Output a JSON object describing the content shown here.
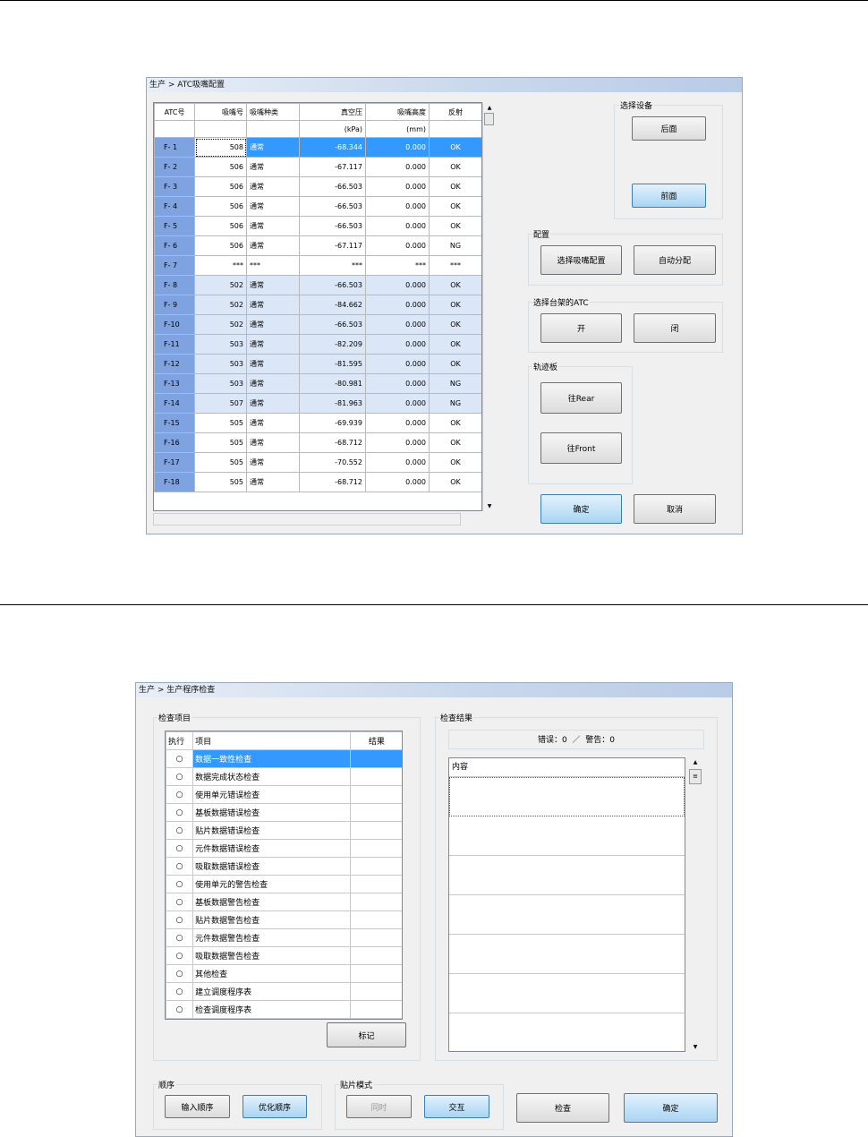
{
  "atc_window": {
    "title": "生产 > ATC吸嘴配置",
    "columns": [
      "ATC号",
      "吸嘴号",
      "吸嘴种类",
      "真空压",
      "吸嘴高度",
      "反射"
    ],
    "units": [
      "",
      "",
      "",
      "(kPa)",
      "(mm)",
      ""
    ],
    "rows": [
      {
        "atc": "F- 1",
        "nozzle": "508",
        "type": "通常",
        "vacuum": "-68.344",
        "height": "0.000",
        "reflect": "OK"
      },
      {
        "atc": "F- 2",
        "nozzle": "506",
        "type": "通常",
        "vacuum": "-67.117",
        "height": "0.000",
        "reflect": "OK"
      },
      {
        "atc": "F- 3",
        "nozzle": "506",
        "type": "通常",
        "vacuum": "-66.503",
        "height": "0.000",
        "reflect": "OK"
      },
      {
        "atc": "F- 4",
        "nozzle": "506",
        "type": "通常",
        "vacuum": "-66.503",
        "height": "0.000",
        "reflect": "OK"
      },
      {
        "atc": "F- 5",
        "nozzle": "506",
        "type": "通常",
        "vacuum": "-66.503",
        "height": "0.000",
        "reflect": "OK"
      },
      {
        "atc": "F- 6",
        "nozzle": "506",
        "type": "通常",
        "vacuum": "-67.117",
        "height": "0.000",
        "reflect": "NG"
      },
      {
        "atc": "F- 7",
        "nozzle": "***",
        "type": "***",
        "vacuum": "***",
        "height": "***",
        "reflect": "***"
      },
      {
        "atc": "F- 8",
        "nozzle": "502",
        "type": "通常",
        "vacuum": "-66.503",
        "height": "0.000",
        "reflect": "OK"
      },
      {
        "atc": "F- 9",
        "nozzle": "502",
        "type": "通常",
        "vacuum": "-84.662",
        "height": "0.000",
        "reflect": "OK"
      },
      {
        "atc": "F-10",
        "nozzle": "502",
        "type": "通常",
        "vacuum": "-66.503",
        "height": "0.000",
        "reflect": "OK"
      },
      {
        "atc": "F-11",
        "nozzle": "503",
        "type": "通常",
        "vacuum": "-82.209",
        "height": "0.000",
        "reflect": "OK"
      },
      {
        "atc": "F-12",
        "nozzle": "503",
        "type": "通常",
        "vacuum": "-81.595",
        "height": "0.000",
        "reflect": "OK"
      },
      {
        "atc": "F-13",
        "nozzle": "503",
        "type": "通常",
        "vacuum": "-80.981",
        "height": "0.000",
        "reflect": "NG"
      },
      {
        "atc": "F-14",
        "nozzle": "507",
        "type": "通常",
        "vacuum": "-81.963",
        "height": "0.000",
        "reflect": "NG"
      },
      {
        "atc": "F-15",
        "nozzle": "505",
        "type": "通常",
        "vacuum": "-69.939",
        "height": "0.000",
        "reflect": "OK"
      },
      {
        "atc": "F-16",
        "nozzle": "505",
        "type": "通常",
        "vacuum": "-68.712",
        "height": "0.000",
        "reflect": "OK"
      },
      {
        "atc": "F-17",
        "nozzle": "505",
        "type": "通常",
        "vacuum": "-70.552",
        "height": "0.000",
        "reflect": "OK"
      },
      {
        "atc": "F-18",
        "nozzle": "505",
        "type": "通常",
        "vacuum": "-68.712",
        "height": "0.000",
        "reflect": "OK"
      }
    ],
    "select_device": {
      "label": "选择设备",
      "rear_button": "后面",
      "front_button": "前面"
    },
    "config": {
      "label": "配置",
      "select_button": "选择吸嘴配置",
      "auto_button": "自动分配"
    },
    "atc_select": {
      "label": "选择台架的ATC",
      "open_button": "开",
      "close_button": "闭"
    },
    "track": {
      "label": "轨迹板",
      "rear_button": "往Rear",
      "front_button": "往Front"
    },
    "ok_button": "确定",
    "cancel_button": "取消"
  },
  "check_window": {
    "title": "生产 > 生产程序检查",
    "items_label": "检查项目",
    "items_header": {
      "exec": "执行",
      "item": "项目",
      "result": "结果"
    },
    "items": [
      "数据一致性检查",
      "数据完成状态检查",
      "使用单元错误检查",
      "基板数据错误检查",
      "贴片数据错误检查",
      "元件数据错误检查",
      "吸取数据错误检查",
      "使用单元的警告检查",
      "基板数据警告检查",
      "贴片数据警告检查",
      "元件数据警告检查",
      "吸取数据警告检查",
      "其他检查",
      "建立调度程序表",
      "检查调度程序表"
    ],
    "mark_button": "标记",
    "results_label": "检查结果",
    "summary": "错误：0  ／  警告：0",
    "content_header": "内容",
    "order_label": "顺序",
    "input_order_button": "输入顺序",
    "optimize_order_button": "优化顺序",
    "mount_mode_label": "贴片模式",
    "simultaneous_button": "同时",
    "alternate_button": "交互",
    "check_button": "检查",
    "confirm_button": "确定"
  }
}
